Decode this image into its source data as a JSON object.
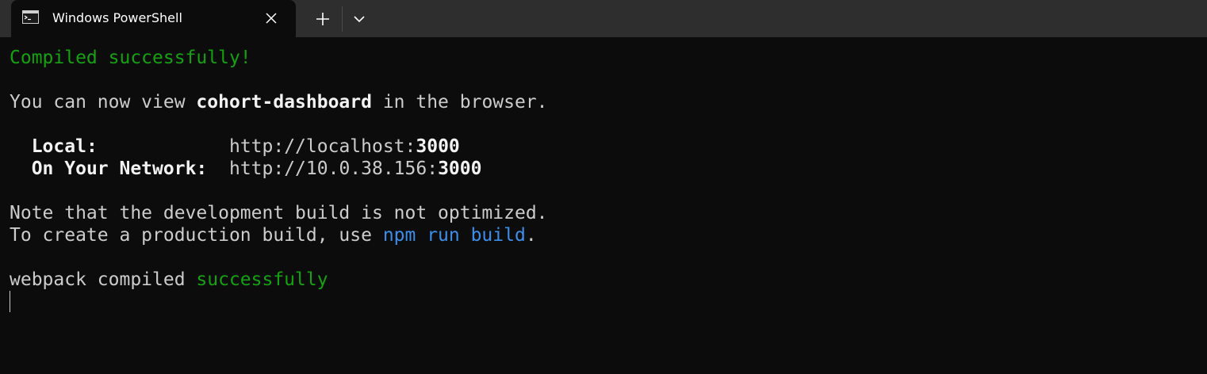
{
  "window": {
    "tab_title": "Windows PowerShell",
    "colors": {
      "background": "#0c0c0c",
      "tabbar": "#2e2e2e",
      "text": "#cccccc",
      "bright": "#f2f2f2",
      "green": "#13a10e",
      "blue": "#3b8eea"
    }
  },
  "terminal": {
    "compiled_msg": "Compiled successfully!",
    "view_prefix": "You can now view ",
    "app_name": "cohort-dashboard",
    "view_suffix": " in the browser.",
    "local_label": "Local:",
    "local_gap": "            ",
    "local_url_base": "http://localhost:",
    "local_port": "3000",
    "network_label": "On Your Network:",
    "network_gap": "  ",
    "network_url_base": "http://10.0.38.156:",
    "network_port": "3000",
    "note_line": "Note that the development build is not optimized.",
    "create_prefix": "To create a production build, use ",
    "build_cmd": "npm run build",
    "create_suffix": ".",
    "webpack_prefix": "webpack compiled ",
    "webpack_status": "successfully"
  }
}
